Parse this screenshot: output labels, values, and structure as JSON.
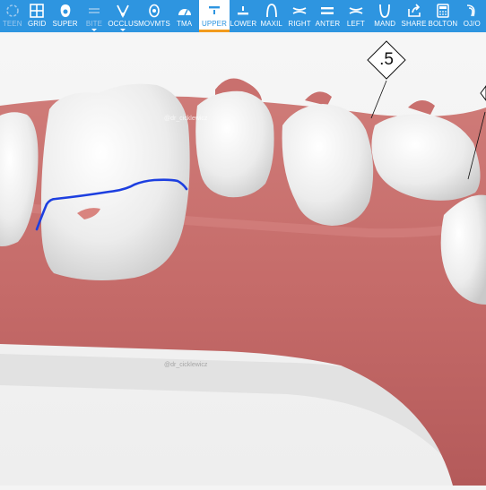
{
  "toolbar": {
    "items": [
      {
        "label": "TEEN",
        "icon": "teeth-icon"
      },
      {
        "label": "GRID",
        "icon": "grid-icon"
      },
      {
        "label": "SUPER",
        "icon": "superimpose-icon"
      },
      {
        "label": "BITE",
        "icon": "bite-icon"
      },
      {
        "label": "OCCLUS",
        "icon": "occlusion-icon"
      },
      {
        "label": "MOVMTS",
        "icon": "movements-icon"
      },
      {
        "label": "TMA",
        "icon": "tma-gauge-icon"
      },
      {
        "label": "UPPER",
        "icon": "upper-arch-icon"
      },
      {
        "label": "LOWER",
        "icon": "lower-arch-icon"
      },
      {
        "label": "MAXIL",
        "icon": "maxillary-icon"
      },
      {
        "label": "RIGHT",
        "icon": "right-view-icon"
      },
      {
        "label": "ANTER",
        "icon": "anterior-view-icon"
      },
      {
        "label": "LEFT",
        "icon": "left-view-icon"
      },
      {
        "label": "MAND",
        "icon": "mandibular-icon"
      },
      {
        "label": "SHARE",
        "icon": "share-icon"
      },
      {
        "label": "BOLTON",
        "icon": "calculator-icon"
      },
      {
        "label": "OJ/O",
        "icon": "overjet-icon"
      }
    ],
    "active": "UPPER",
    "colors": {
      "bar": "#2e95e0",
      "active_underline": "#f29b1d"
    }
  },
  "viewport": {
    "measurement_label": ".5",
    "watermark_top": "@dr_cicklewicz",
    "watermark_bottom": "@dr_cicklewicz"
  }
}
